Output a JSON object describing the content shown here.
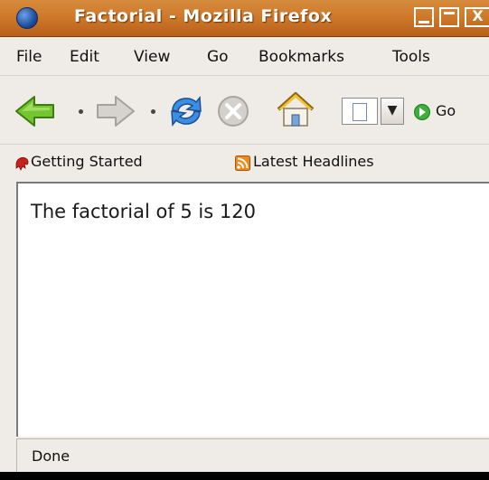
{
  "window": {
    "title": "Factorial - Mozilla Firefox",
    "close_glyph": "X"
  },
  "menu": {
    "items": [
      "File",
      "Edit",
      "View",
      "Go",
      "Bookmarks",
      "Tools"
    ]
  },
  "navigation": {
    "go_label": "Go",
    "icons": [
      "back-arrow-icon",
      "forward-arrow-icon",
      "reload-icon",
      "stop-icon",
      "home-icon",
      "page-icon",
      "dropdown-arrow-icon",
      "go-icon"
    ]
  },
  "bookmarks": {
    "items": [
      "Getting Started",
      "Latest Headlines"
    ]
  },
  "content": {
    "text": "The factorial of 5 is 120"
  },
  "status": {
    "text": "Done"
  },
  "colors": {
    "titlebar": "#cf7a2a",
    "chrome": "#efebe7",
    "content_bg": "#ffffff"
  }
}
